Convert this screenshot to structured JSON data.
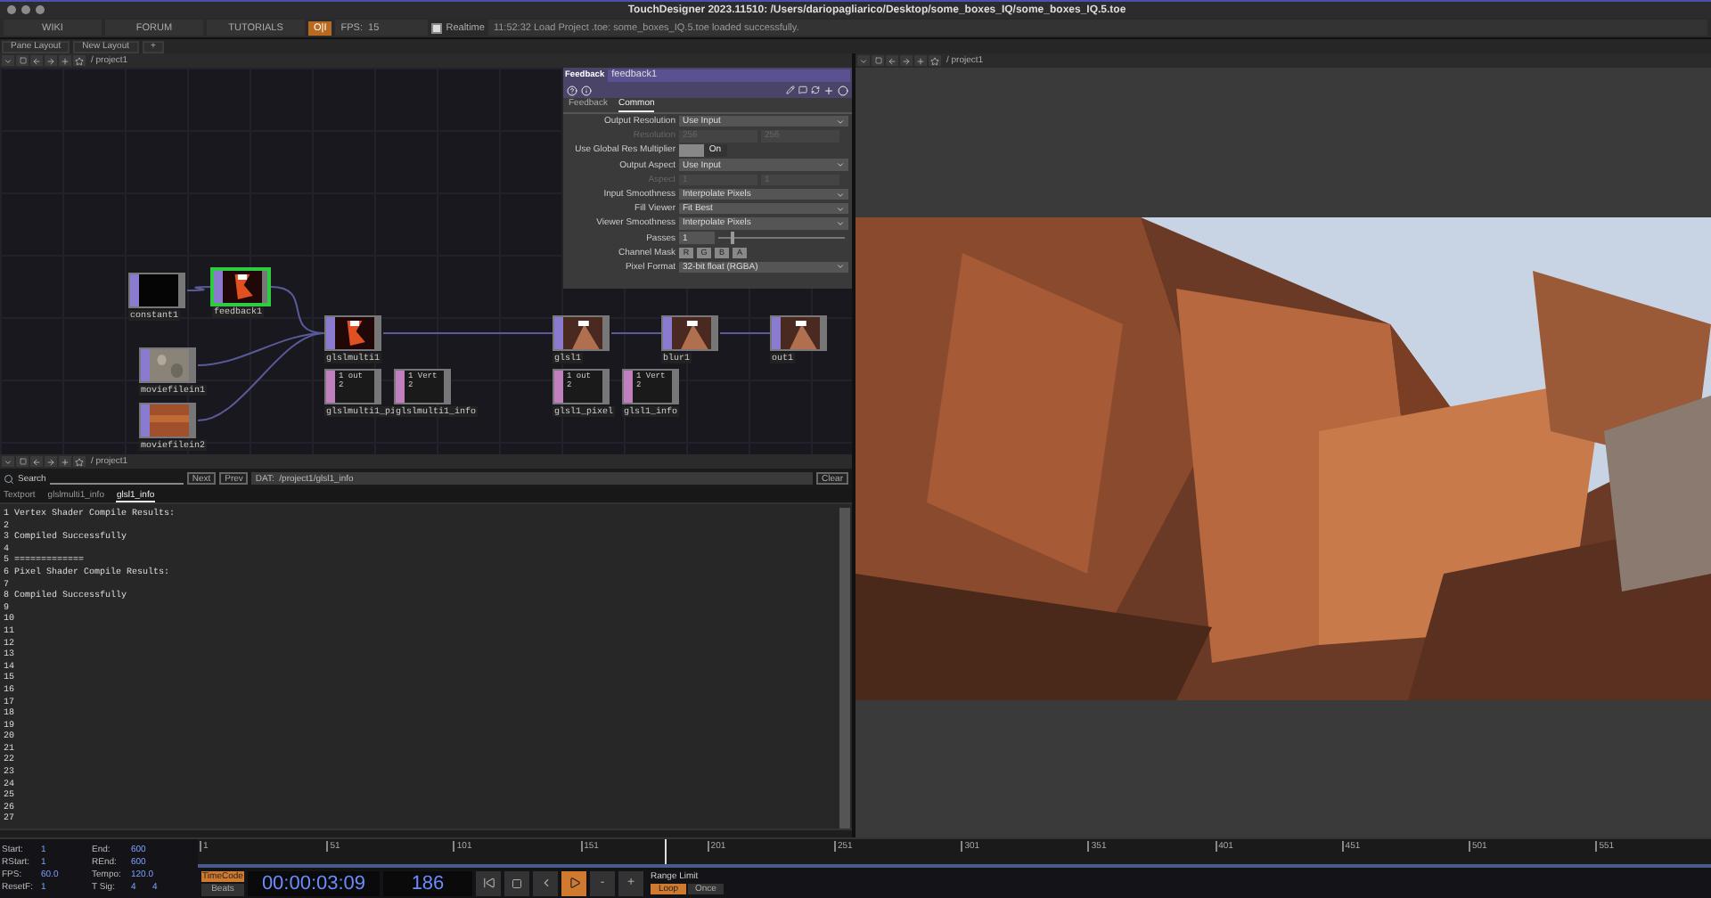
{
  "window": {
    "title": "TouchDesigner 2023.11510: /Users/dariopagliarico/Desktop/some_boxes_IQ/some_boxes_IQ.5.toe"
  },
  "top_bar": {
    "links": [
      "WIKI",
      "FORUM",
      "TUTORIALS"
    ],
    "perform_toggle": "O|I",
    "fps_label": "FPS:",
    "fps": "15",
    "realtime": {
      "label": "Realtime",
      "checked": true
    },
    "message": "11:52:32 Load Project .toe: some_boxes_IQ.5.toe loaded successfully."
  },
  "layout_bar": {
    "pane_layout": "Pane Layout",
    "new_layout": "New Layout",
    "add": "+"
  },
  "network": {
    "path": "/ project1",
    "nodes": [
      {
        "name": "constant1",
        "kind": "top",
        "selected": false
      },
      {
        "name": "feedback1",
        "kind": "top",
        "selected": true
      },
      {
        "name": "glslmulti1",
        "kind": "top",
        "selected": false
      },
      {
        "name": "moviefilein1",
        "kind": "top",
        "selected": false
      },
      {
        "name": "moviefilein2",
        "kind": "top",
        "selected": false
      },
      {
        "name": "glsl1",
        "kind": "top",
        "selected": false
      },
      {
        "name": "blur1",
        "kind": "top",
        "selected": false
      },
      {
        "name": "out1",
        "kind": "top",
        "selected": false
      },
      {
        "name": "glslmulti1_pi",
        "kind": "dat",
        "selected": false,
        "lines": [
          "1 out",
          "2"
        ]
      },
      {
        "name": "glslmulti1_info",
        "kind": "dat",
        "selected": false,
        "lines": [
          "1 Vert",
          "2"
        ]
      },
      {
        "name": "glsl1_pixel",
        "kind": "dat",
        "selected": false,
        "lines": [
          "1 out",
          "2"
        ]
      },
      {
        "name": "glsl1_info",
        "kind": "dat",
        "selected": false,
        "lines": [
          "1 Vert",
          "2"
        ]
      }
    ]
  },
  "parameters": {
    "op_type": "Feedback",
    "op_name": "feedback1",
    "tabs": [
      {
        "label": "Feedback",
        "selected": false
      },
      {
        "label": "Common",
        "selected": true
      }
    ],
    "params": [
      {
        "kind": "menu",
        "label": "Output Resolution",
        "value": "Use Input",
        "disabled": false
      },
      {
        "kind": "pair",
        "label": "Resolution",
        "values": [
          "256",
          "256"
        ],
        "disabled": true
      },
      {
        "kind": "toggle",
        "label": "Use Global Res Multiplier",
        "value": "On",
        "on": true,
        "disabled": false
      },
      {
        "kind": "menu",
        "label": "Output Aspect",
        "value": "Use Input",
        "disabled": false
      },
      {
        "kind": "pair",
        "label": "Aspect",
        "values": [
          "1",
          "1"
        ],
        "disabled": true
      },
      {
        "kind": "menu",
        "label": "Input Smoothness",
        "value": "Interpolate Pixels",
        "disabled": false
      },
      {
        "kind": "menu",
        "label": "Fill Viewer",
        "value": "Fit Best",
        "disabled": false
      },
      {
        "kind": "menu",
        "label": "Viewer Smoothness",
        "value": "Interpolate Pixels",
        "disabled": false
      },
      {
        "kind": "slider",
        "label": "Passes",
        "value": "1",
        "level": 0.1,
        "disabled": false
      },
      {
        "kind": "buttons",
        "label": "Channel Mask",
        "buttons": [
          "R",
          "G",
          "B",
          "A"
        ],
        "disabled": false
      },
      {
        "kind": "menu",
        "label": "Pixel Format",
        "value": "32-bit float (RGBA)",
        "disabled": false
      }
    ]
  },
  "textport": {
    "path": "/ project1",
    "search_label": "Search",
    "next": "Next",
    "prev": "Prev",
    "dat_path": "DAT:  /project1/glsl1_info",
    "clear": "Clear",
    "tabs": [
      {
        "label": "Textport",
        "selected": false
      },
      {
        "label": "glslmulti1_info",
        "selected": false
      },
      {
        "label": "glsl1_info",
        "selected": true
      }
    ],
    "lines": [
      {
        "number": "1",
        "text": "Vertex Shader Compile Results:"
      },
      {
        "number": "2"
      },
      {
        "number": "3",
        "text": "Compiled Successfully"
      },
      {
        "number": "4"
      },
      {
        "number": "5",
        "text": "============="
      },
      {
        "number": "6",
        "text": "Pixel Shader Compile Results:"
      },
      {
        "number": "7"
      },
      {
        "number": "8",
        "text": "Compiled Successfully"
      },
      {
        "number": "9"
      },
      {
        "number": "10"
      },
      {
        "number": "11"
      },
      {
        "number": "12"
      },
      {
        "number": "13"
      },
      {
        "number": "14"
      },
      {
        "number": "15"
      },
      {
        "number": "16"
      },
      {
        "number": "17"
      },
      {
        "number": "18"
      },
      {
        "number": "19"
      },
      {
        "number": "20"
      },
      {
        "number": "21"
      },
      {
        "number": "22"
      },
      {
        "number": "23"
      },
      {
        "number": "24"
      },
      {
        "number": "25"
      },
      {
        "number": "26"
      },
      {
        "number": "27"
      }
    ]
  },
  "viewer": {
    "path": "/ project1",
    "kind": "picture"
  },
  "timeline": {
    "stats": [
      {
        "label": "Start:",
        "values": [
          "1"
        ]
      },
      {
        "label": "End:",
        "values": [
          "600"
        ]
      },
      {
        "label": "RStart:",
        "values": [
          "1"
        ]
      },
      {
        "label": "REnd:",
        "values": [
          "600"
        ]
      },
      {
        "label": "FPS:",
        "values": [
          "60.0"
        ]
      },
      {
        "label": "Tempo:",
        "values": [
          "120.0"
        ]
      },
      {
        "label": "ResetF:",
        "values": [
          "1"
        ]
      },
      {
        "label": "T Sig:",
        "values": [
          "4",
          "4"
        ]
      }
    ],
    "ticks": [
      "1",
      "51",
      "101",
      "151",
      "201",
      "251",
      "301",
      "351",
      "401",
      "451",
      "501",
      "551"
    ],
    "playhead": {
      "level": 0.309
    },
    "time_modes": [
      {
        "label": "TimeCode",
        "selected": true
      },
      {
        "label": "Beats",
        "selected": false
      }
    ],
    "timecode": "00:00:03:09",
    "frame": "186",
    "transport": [
      {
        "kind": "start",
        "selected": false
      },
      {
        "kind": "stop",
        "selected": false
      },
      {
        "kind": "back",
        "selected": false
      },
      {
        "kind": "play",
        "selected": true
      },
      {
        "kind": "minus",
        "label": "-",
        "selected": false
      },
      {
        "kind": "plus",
        "label": "+",
        "selected": false
      }
    ],
    "range_limit": {
      "label": "Range Limit",
      "options": [
        {
          "label": "Loop",
          "selected": true
        },
        {
          "label": "Once",
          "selected": false
        }
      ]
    }
  }
}
